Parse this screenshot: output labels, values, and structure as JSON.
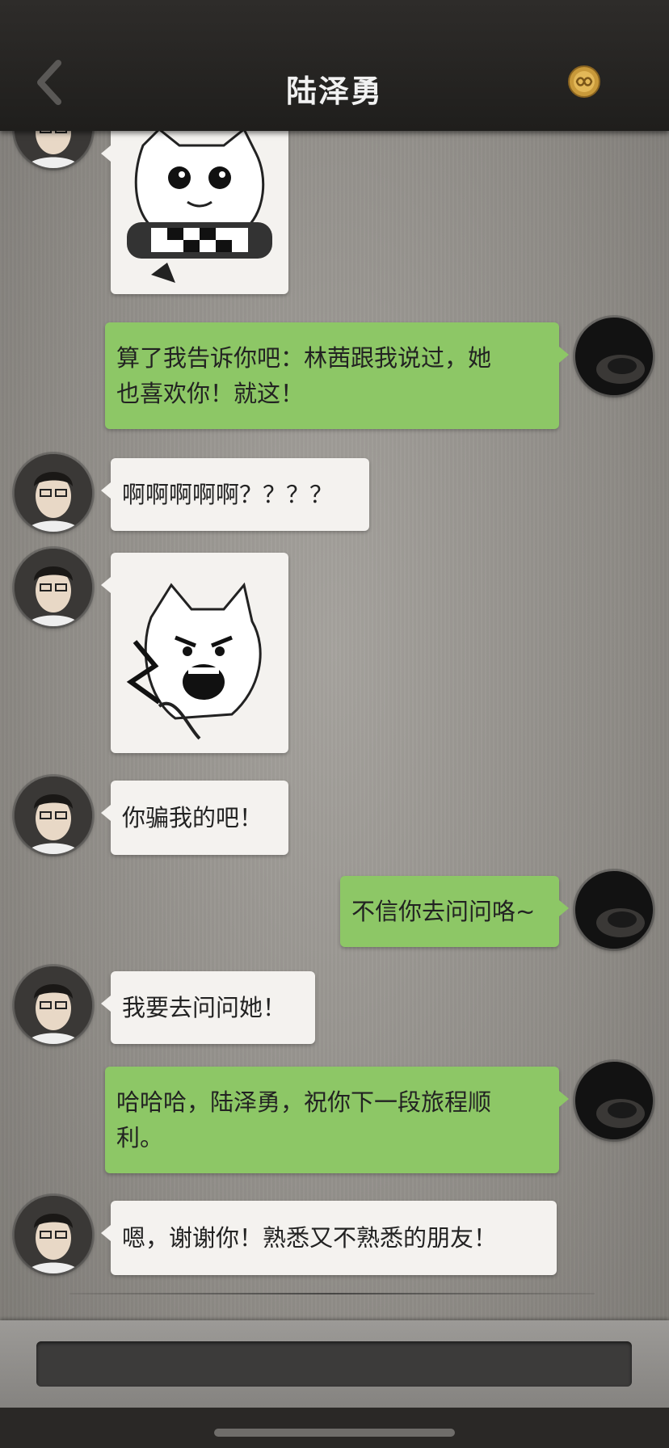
{
  "header": {
    "title": "陆泽勇",
    "back_icon": "chevron-left-icon",
    "badge_icon": "gold-coin-infinity-icon"
  },
  "messages": [
    {
      "from": "them",
      "type": "sticker",
      "sticker": "cat-sticker-grimace"
    },
    {
      "from": "me",
      "type": "text",
      "lines": [
        "算了我告诉你吧：林茜跟我说过，她",
        "也喜欢你！就这！"
      ]
    },
    {
      "from": "them",
      "type": "text",
      "lines": [
        "啊啊啊啊啊？？？？"
      ]
    },
    {
      "from": "them",
      "type": "sticker",
      "sticker": "cat-sticker-shout"
    },
    {
      "from": "them",
      "type": "text",
      "lines": [
        "你骗我的吧！"
      ]
    },
    {
      "from": "me",
      "type": "text",
      "lines": [
        "不信你去问问咯~"
      ]
    },
    {
      "from": "them",
      "type": "text",
      "lines": [
        "我要去问问她！"
      ]
    },
    {
      "from": "me",
      "type": "text",
      "lines": [
        "哈哈哈，陆泽勇，祝你下一段旅程顺",
        "利。"
      ]
    },
    {
      "from": "them",
      "type": "text",
      "lines": [
        "嗯，谢谢你！熟悉又不熟悉的朋友！"
      ]
    }
  ],
  "input": {
    "placeholder": "",
    "value": ""
  },
  "colors": {
    "outgoing_bubble": "#8dc766",
    "incoming_bubble": "#f4f2ef",
    "topbar": "#262422"
  }
}
